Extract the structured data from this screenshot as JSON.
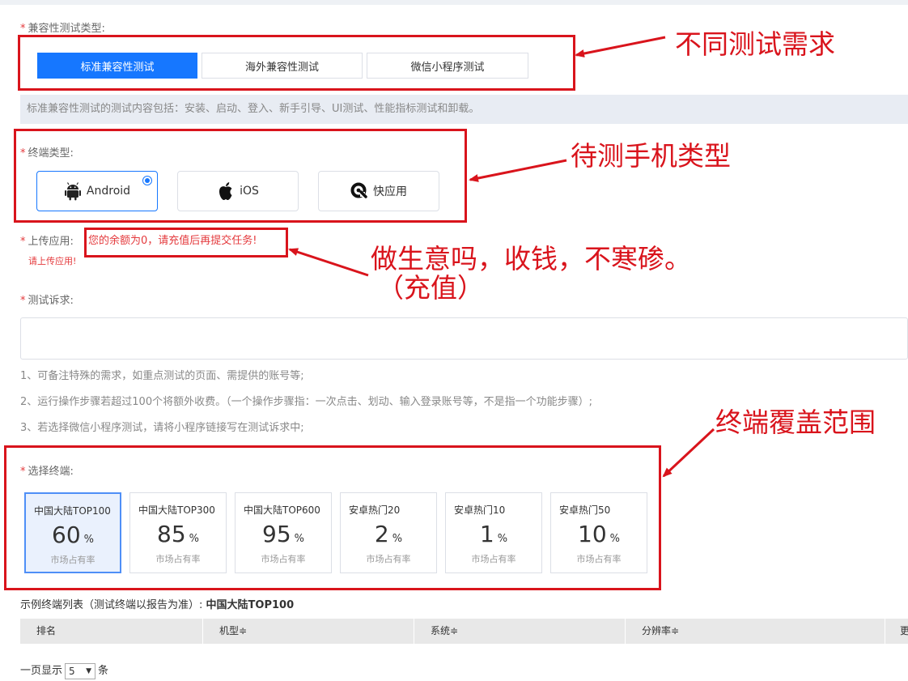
{
  "compat": {
    "label": "兼容性测试类型:",
    "tabs": [
      {
        "label": "标准兼容性测试",
        "active": true
      },
      {
        "label": "海外兼容性测试",
        "active": false
      },
      {
        "label": "微信小程序测试",
        "active": false
      }
    ],
    "info": "标准兼容性测试的测试内容包括：安装、启动、登入、新手引导、UI测试、性能指标测试和卸载。"
  },
  "terminal_type": {
    "label": "终端类型:",
    "options": [
      {
        "label": "Android",
        "icon": "android-icon",
        "selected": true
      },
      {
        "label": "iOS",
        "icon": "apple-icon",
        "selected": false
      },
      {
        "label": "快应用",
        "icon": "quickapp-icon",
        "selected": false
      }
    ]
  },
  "upload": {
    "label": "上传应用:",
    "warning": "您的余额为0，请充值后再提交任务!",
    "hint": "请上传应用!"
  },
  "demand": {
    "label": "测试诉求:",
    "notes": [
      "1、可备注特殊的需求，如重点测试的页面、需提供的账号等;",
      "2、运行操作步骤若超过100个将额外收费。（一个操作步骤指：一次点击、划动、输入登录账号等，不是指一个功能步骤）;",
      "3、若选择微信小程序测试，请将小程序链接写在测试诉求中;"
    ]
  },
  "select_terminal": {
    "label": "选择终端:",
    "cards": [
      {
        "title": "中国大陆TOP100",
        "value": "60",
        "unit": "%",
        "sub": "市场占有率",
        "active": true
      },
      {
        "title": "中国大陆TOP300",
        "value": "85",
        "unit": "%",
        "sub": "市场占有率",
        "active": false
      },
      {
        "title": "中国大陆TOP600",
        "value": "95",
        "unit": "%",
        "sub": "市场占有率",
        "active": false
      },
      {
        "title": "安卓热门20",
        "value": "2",
        "unit": "%",
        "sub": "市场占有率",
        "active": false
      },
      {
        "title": "安卓热门10",
        "value": "1",
        "unit": "%",
        "sub": "市场占有率",
        "active": false
      },
      {
        "title": "安卓热门50",
        "value": "10",
        "unit": "%",
        "sub": "市场占有率",
        "active": false
      }
    ]
  },
  "list": {
    "caption": "示例终端列表（测试终端以报告为准）:",
    "caption_strong": "中国大陆TOP100",
    "columns": [
      "排名",
      "机型≑",
      "系统≑",
      "分辨率≑",
      "更"
    ],
    "per_page_prefix": "一页显示",
    "per_page_value": "5",
    "per_page_suffix": "条"
  },
  "annotations": {
    "a1": "不同测试需求",
    "a2": "待测手机类型",
    "a3_line1": "做生意吗，收钱，不寒碜。",
    "a3_line2": "（充值）",
    "a4": "终端覆盖范围"
  },
  "colors": {
    "primary": "#1677ff",
    "annotation_red": "#d9141c",
    "required_star": "#e4393c"
  }
}
